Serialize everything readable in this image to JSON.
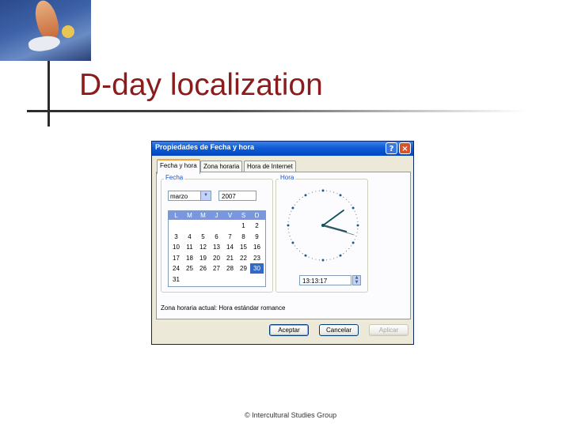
{
  "slide": {
    "title": "D-day localization",
    "footer": "© Intercultural Studies Group"
  },
  "dialog": {
    "title": "Propiedades de Fecha y hora",
    "help_glyph": "?",
    "close_glyph": "×",
    "tabs": [
      {
        "label": "Fecha y hora",
        "active": true
      },
      {
        "label": "Zona horaria",
        "active": false
      },
      {
        "label": "Hora de Internet",
        "active": false
      }
    ],
    "date_group": {
      "label": "Fecha",
      "month": "marzo",
      "year": "2007",
      "weekday_headers": [
        "L",
        "M",
        "M",
        "J",
        "V",
        "S",
        "D"
      ],
      "weeks": [
        [
          "",
          "",
          "",
          "",
          "",
          "1",
          "2"
        ],
        [
          "3",
          "4",
          "5",
          "6",
          "7",
          "8",
          "9"
        ],
        [
          "10",
          "11",
          "12",
          "13",
          "14",
          "15",
          "16"
        ],
        [
          "17",
          "18",
          "19",
          "20",
          "21",
          "22",
          "23"
        ],
        [
          "24",
          "25",
          "26",
          "27",
          "28",
          "29",
          "30"
        ],
        [
          "31",
          "",
          "",
          "",
          "",
          "",
          ""
        ]
      ],
      "selected_day": "30"
    },
    "time_group": {
      "label": "Hora",
      "time": "13:13:17"
    },
    "timezone_text": "Zona horaria actual: Hora estándar romance",
    "buttons": {
      "ok": "Aceptar",
      "cancel": "Cancelar",
      "apply": "Aplicar"
    },
    "colors": {
      "title_bar": "#0c5ad5",
      "dialog_bg": "#ece9d8",
      "selected_day_bg": "#316ac5",
      "slide_title": "#8b1c1c"
    }
  }
}
